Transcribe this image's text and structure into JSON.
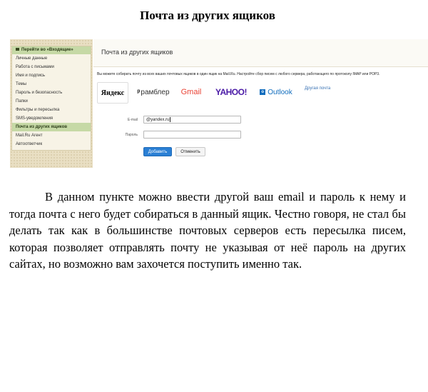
{
  "document": {
    "title": "Почта из других ящиков",
    "paragraph": "В данном пункте можно ввести другой ваш email и пароль к нему и тогда почта с него будет собираться в данный ящик. Честно говоря, не стал бы делать так как в большинстве почтовых серверов есть пересылка писем, которая позволяет отправлять почту не указывая от неё пароль на других сайтах, но возможно вам захочется поступить именно так."
  },
  "screenshot": {
    "sidebar": {
      "header": "Перейти во «Входящие»",
      "items": [
        "Личные данные",
        "Работа с письмами",
        "Имя и подпись",
        "Темы",
        "Пароль и безопасность",
        "Папки",
        "Фильтры и пересылка",
        "SMS-уведомления",
        "Почта из других ящиков",
        "Mail.Ru Агент",
        "Автоответчик"
      ],
      "active_index": 8
    },
    "main": {
      "title": "Почта из других ящиков",
      "description": "Вы можете собирать почту из всех ваших почтовых ящиков в один ящик на Mail.Ru. Настройте сбор писем с любого сервера, работающего по протоколу IMAP или POP3.",
      "providers": {
        "yandex": "Яндекс",
        "rambler": "рамблер",
        "gmail": "Gmail",
        "yahoo": "YAHOO!",
        "outlook": "Outlook",
        "other": "Другая почта"
      },
      "form": {
        "email_label": "E-mail",
        "email_value": "@yandex.ru",
        "password_label": "Пароль",
        "password_value": "",
        "submit_label": "Добавить",
        "cancel_label": "Отменить"
      }
    }
  },
  "colors": {
    "sidebar_bg": "#e9dfc3",
    "sidebar_active": "#c6d9a6",
    "primary_button": "#2a7fd4",
    "yandex_red": "#e11111",
    "yahoo_purple": "#4a1aa6",
    "outlook_blue": "#0f6cbd"
  }
}
